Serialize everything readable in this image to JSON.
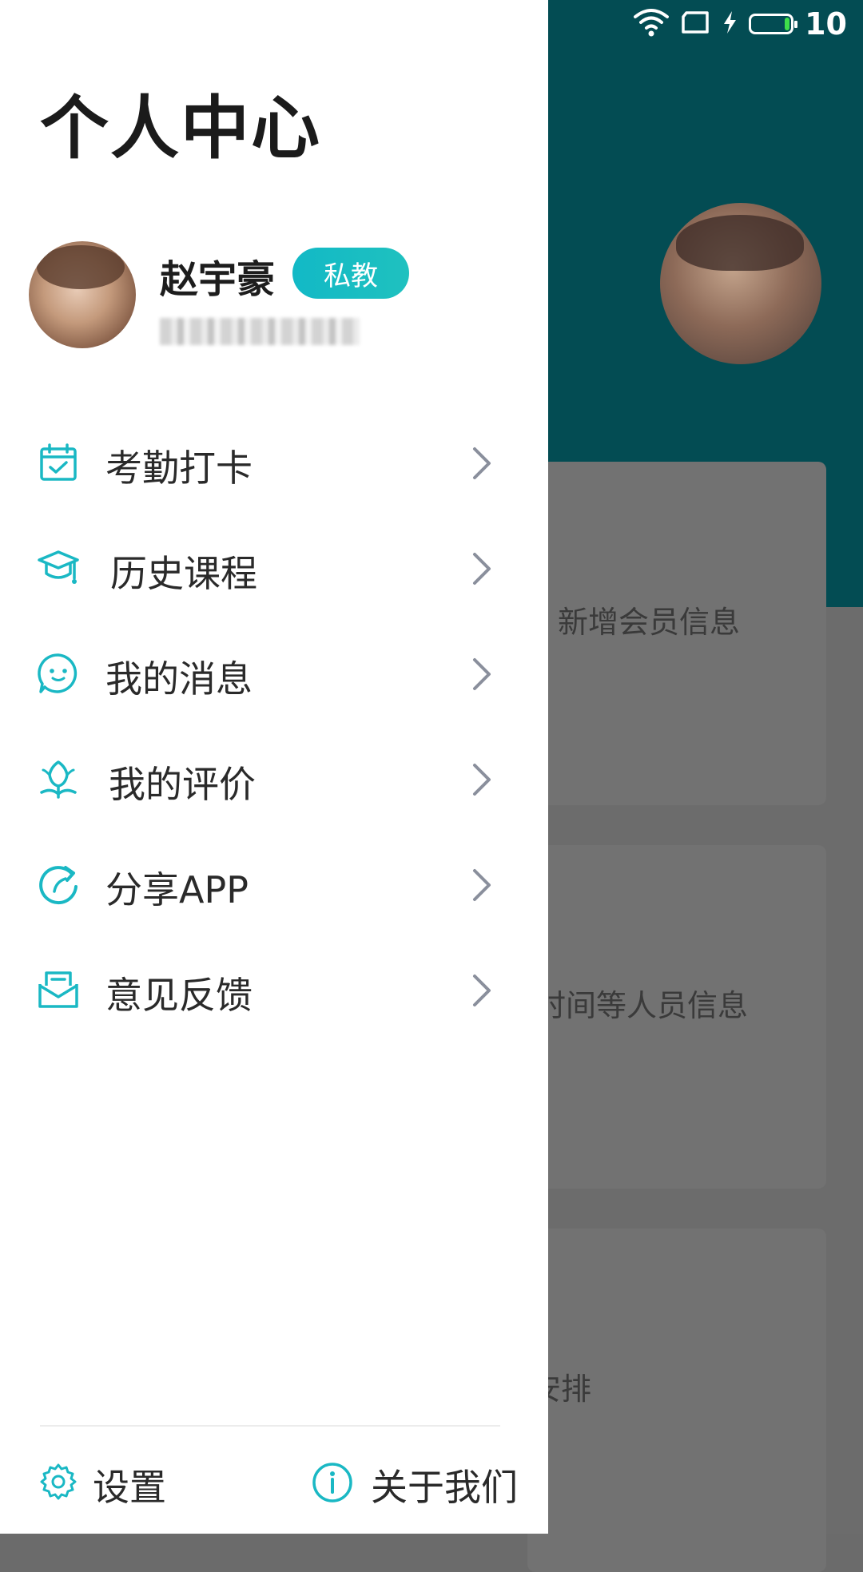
{
  "status_bar": {
    "battery_level": "10"
  },
  "background_app": {
    "cards": [
      {
        "text": "新增会员信息"
      },
      {
        "text": "时间等人员信息"
      },
      {
        "text": "安排"
      }
    ]
  },
  "drawer": {
    "title": "个人中心",
    "user": {
      "name": "赵宇豪",
      "role_badge": "私教"
    },
    "menu": [
      {
        "label": "考勤打卡",
        "icon": "calendar-check-icon"
      },
      {
        "label": "历史课程",
        "icon": "graduation-cap-icon"
      },
      {
        "label": "我的消息",
        "icon": "chat-smile-icon"
      },
      {
        "label": "我的评价",
        "icon": "flower-icon"
      },
      {
        "label": "分享APP",
        "icon": "share-refresh-icon"
      },
      {
        "label": "意见反馈",
        "icon": "envelope-icon"
      }
    ],
    "footer": {
      "settings_label": "设置",
      "about_label": "关于我们"
    }
  },
  "colors": {
    "accent": "#1ab8c4",
    "header_bg": "#034c53",
    "overlay_bg": "#6c6c6c"
  }
}
